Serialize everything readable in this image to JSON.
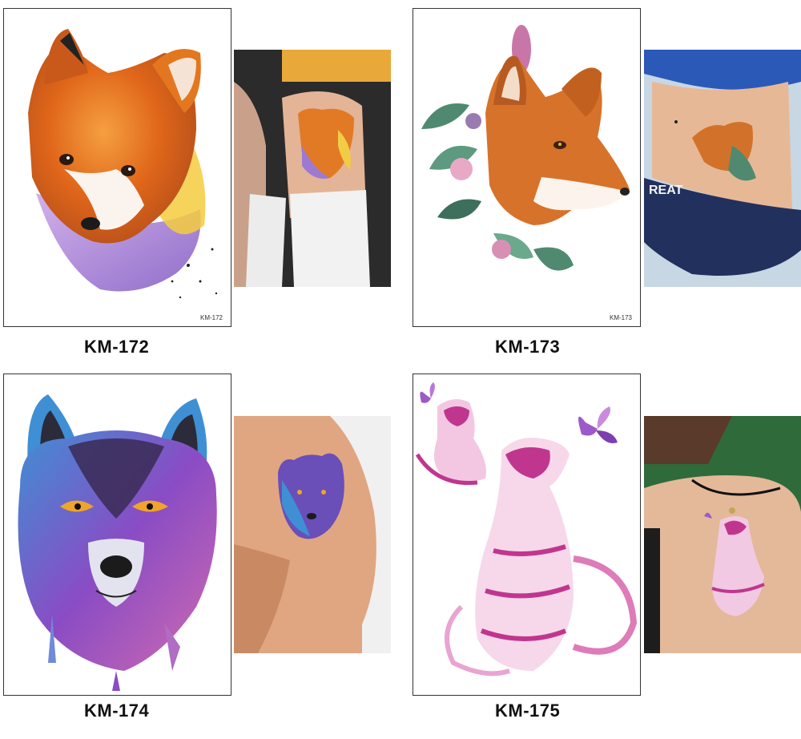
{
  "items": [
    {
      "code": "KM-172",
      "sheet_label": "KM-172",
      "subject": "fox"
    },
    {
      "code": "KM-173",
      "sheet_label": "KM-173",
      "subject": "fox-with-flowers"
    },
    {
      "code": "KM-174",
      "sheet_label": "",
      "subject": "wolf"
    },
    {
      "code": "KM-175",
      "sheet_label": "",
      "subject": "tiger-with-butterflies"
    }
  ],
  "photos": [
    {
      "text": ""
    },
    {
      "text": "REAT"
    },
    {
      "text": ""
    },
    {
      "text": ""
    }
  ],
  "colors": {
    "fox_orange": "#e8791f",
    "wolf_blue": "#3f8fd4",
    "wolf_purple": "#8a4cc4",
    "tiger_pink": "#c0368f",
    "skin": "#e9b99a"
  }
}
